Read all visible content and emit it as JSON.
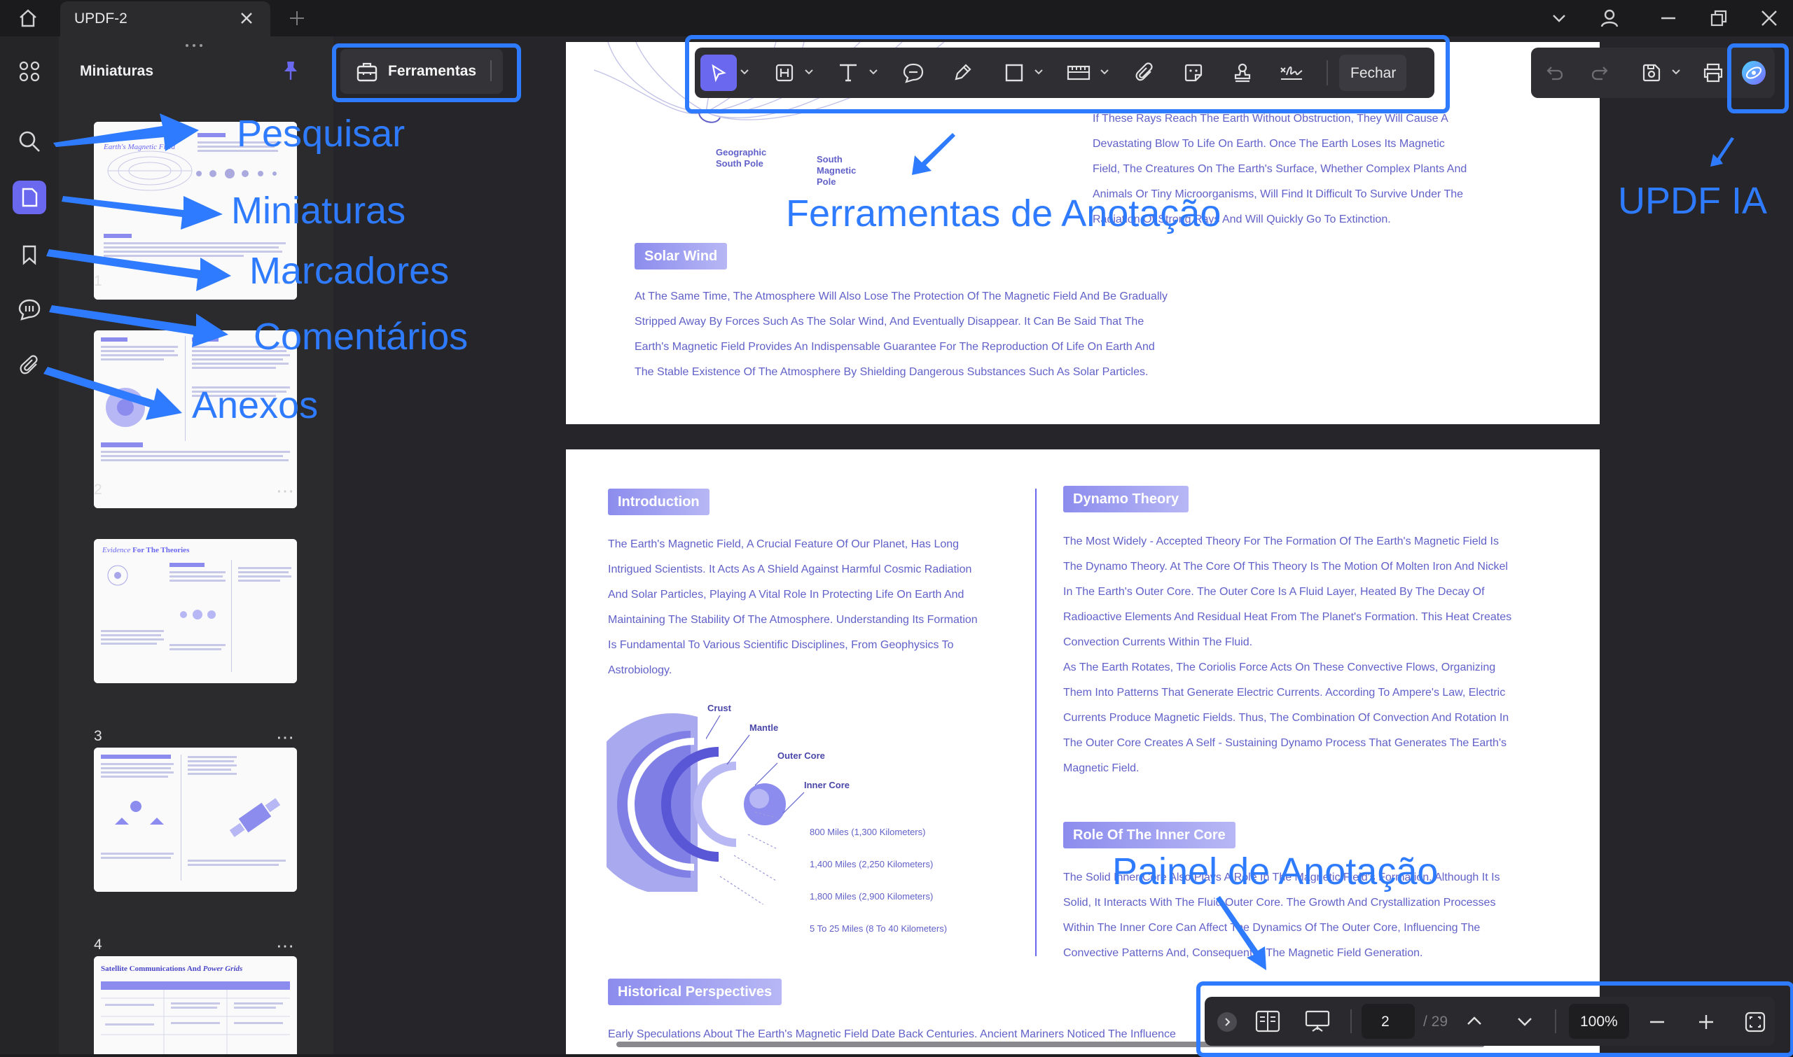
{
  "titlebar": {
    "tab_label": "UPDF-2"
  },
  "left_panel": {
    "title": "Miniaturas"
  },
  "thumbnails": [
    {
      "num": "1",
      "title": "Earth's Magnetic Field"
    },
    {
      "num": "2",
      "title": ""
    },
    {
      "num": "3",
      "title_a": "Evidence",
      "title_b": " For The Theories"
    },
    {
      "num": "4",
      "title": ""
    },
    {
      "num": "",
      "title_a": "Satellite Communications And",
      "title_b": " Power Grids"
    }
  ],
  "tools_button": {
    "label": "Ferramentas"
  },
  "annotation_toolbar": {
    "close_label": "Fechar"
  },
  "page1": {
    "labels": {
      "geo_south": "Geographic\nSouth Pole",
      "south_mag": "South\nMagnetic\nPole"
    },
    "right_text": [
      "If These Rays Reach The Earth Without Obstruction, They Will Cause A",
      "Devastating Blow To Life On Earth. Once The Earth Loses Its Magnetic",
      "Field, The Creatures On The Earth's Surface, Whether Complex Plants And",
      "Animals Or Tiny Microorganisms, Will Find It Difficult To Survive Under The",
      "Radiation Of Strong Rays And Will Quickly Go To Extinction."
    ],
    "solar_wind": "Solar Wind",
    "solar_text": [
      "At The Same Time, The Atmosphere Will Also Lose The Protection Of The Magnetic Field And Be Gradually",
      "Stripped Away By Forces Such As The Solar Wind, And Eventually Disappear. It Can Be Said That The",
      "Earth's Magnetic Field Provides An Indispensable Guarantee For The Reproduction Of Life On Earth And",
      "The Stable Existence Of The Atmosphere By Shielding Dangerous Substances Such As Solar Particles."
    ]
  },
  "page2": {
    "introduction": "Introduction",
    "intro_text": [
      "The Earth's Magnetic Field, A Crucial Feature Of Our Planet, Has Long",
      "Intrigued Scientists. It Acts As A Shield Against Harmful Cosmic Radiation",
      "And Solar Particles, Playing A Vital Role In Protecting Life On Earth And",
      "Maintaining The Stability Of The Atmosphere. Understanding Its Formation",
      "Is Fundamental To Various Scientific Disciplines, From Geophysics To",
      "Astrobiology."
    ],
    "layers": {
      "crust": "Crust",
      "mantle": "Mantle",
      "outer": "Outer Core",
      "inner": "Inner Core"
    },
    "distances": [
      "800 Miles (1,300 Kilometers)",
      "1,400 Miles (2,250 Kilometers)",
      "1,800 Miles (2,900 Kilometers)",
      "5 To 25 Miles (8 To 40 Kilometers)"
    ],
    "historical": "Historical Perspectives",
    "historical_text": "Early Speculations About The Earth's Magnetic Field Date Back Centuries. Ancient Mariners Noticed The Influence",
    "dynamo": "Dynamo Theory",
    "dynamo_text": [
      "The Most Widely - Accepted Theory For The Formation Of The Earth's Magnetic Field Is",
      "The Dynamo Theory. At The Core Of This Theory Is The Motion Of Molten Iron And Nickel",
      "In The Earth's Outer Core. The Outer Core Is A Fluid Layer, Heated By The Decay Of",
      "Radioactive Elements And Residual Heat From The Planet's Formation. This Heat Creates",
      "Convection Currents Within The Fluid.",
      "As The Earth Rotates, The Coriolis Force Acts On These Convective Flows, Organizing",
      "Them Into Patterns That Generate Electric Currents. According To Ampere's Law, Electric",
      "Currents Produce Magnetic Fields. Thus, The Combination Of Convection And Rotation In",
      "The Outer Core Creates A Self - Sustaining Dynamo Process That Generates The Earth's",
      "Magnetic Field."
    ],
    "role": "Role Of The Inner Core",
    "role_text": [
      "The Solid Inner Core Also Plays A Role In The Magnetic Field's Formation. Although It Is",
      "Solid, It Interacts With The Fluid Outer Core. The Growth And Crystallization Processes",
      "Within The Inner Core Can Affect The Dynamics Of The Outer Core, Influencing The",
      "Convective Patterns And, Consequently, The Magnetic Field Generation."
    ]
  },
  "bottom_bar": {
    "page_value": "2",
    "page_total": "/ 29",
    "zoom": "100%"
  },
  "annotations": {
    "search": "Pesquisar",
    "thumbnails": "Miniaturas",
    "bookmarks": "Marcadores",
    "comments": "Comentários",
    "attachments": "Anexos",
    "annotation_tools": "Ferramentas de Anotação",
    "updf_ai": "UPDF IA",
    "annotation_panel": "Painel de Anotação"
  },
  "colors": {
    "accent": "#6b68f0",
    "annotation_blue": "#2f7bff",
    "section_purple": "#8c8cee"
  },
  "icons": [
    "home-icon",
    "plus-icon",
    "chevron-down-icon",
    "user-icon",
    "minimize-icon",
    "restore-icon",
    "close-icon",
    "grid-icon",
    "search-icon",
    "thumbnails-icon",
    "bookmark-icon",
    "comment-icon",
    "paperclip-icon",
    "pin-icon",
    "toolbox-icon",
    "cursor-icon",
    "highlight-icon",
    "text-icon",
    "comment-bubble-icon",
    "pencil-icon",
    "rectangle-icon",
    "measure-icon",
    "attach-icon",
    "sticker-icon",
    "stamp-icon",
    "signature-icon",
    "undo-icon",
    "redo-icon",
    "save-icon",
    "print-icon",
    "ai-icon",
    "chevron-right-icon",
    "single-page-icon",
    "presentation-icon",
    "chevron-up-icon",
    "zoom-out-icon",
    "zoom-in-icon",
    "fit-icon"
  ]
}
